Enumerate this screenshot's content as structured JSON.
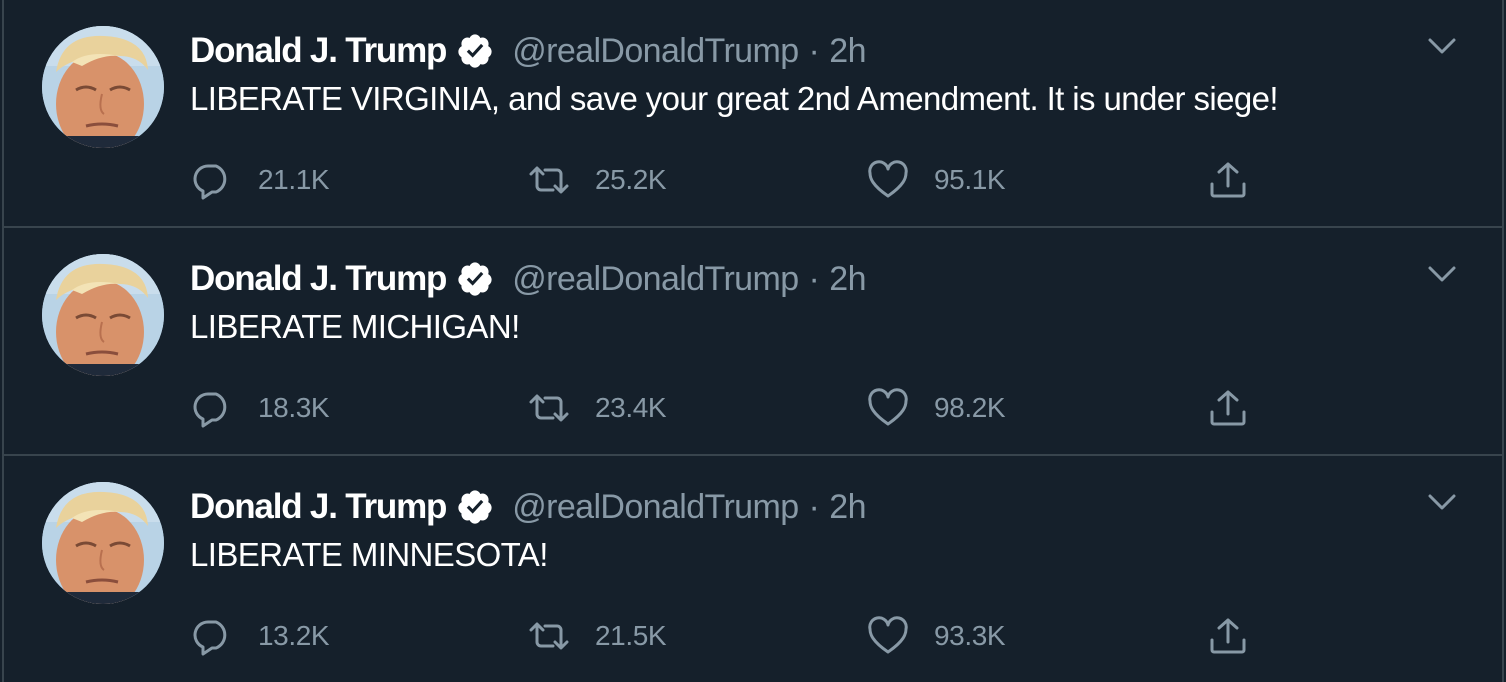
{
  "tweets": [
    {
      "author": "Donald J. Trump",
      "handle": "@realDonaldTrump",
      "separator": "·",
      "time": "2h",
      "text": "LIBERATE VIRGINIA, and save your great 2nd Amendment. It is under siege!",
      "replies": "21.1K",
      "retweets": "25.2K",
      "likes": "95.1K"
    },
    {
      "author": "Donald J. Trump",
      "handle": "@realDonaldTrump",
      "separator": "·",
      "time": "2h",
      "text": "LIBERATE MICHIGAN!",
      "replies": "18.3K",
      "retweets": "23.4K",
      "likes": "98.2K"
    },
    {
      "author": "Donald J. Trump",
      "handle": "@realDonaldTrump",
      "separator": "·",
      "time": "2h",
      "text": "LIBERATE MINNESOTA!",
      "replies": "13.2K",
      "retweets": "21.5K",
      "likes": "93.3K"
    }
  ],
  "icons": {
    "verified": "verified-badge-icon",
    "reply": "reply-icon",
    "retweet": "retweet-icon",
    "like": "heart-icon",
    "share": "share-icon",
    "menu": "chevron-down-icon"
  },
  "colors": {
    "background": "#15202b",
    "divider": "#38444d",
    "primary_text": "#ffffff",
    "secondary_text": "#8899a6"
  }
}
